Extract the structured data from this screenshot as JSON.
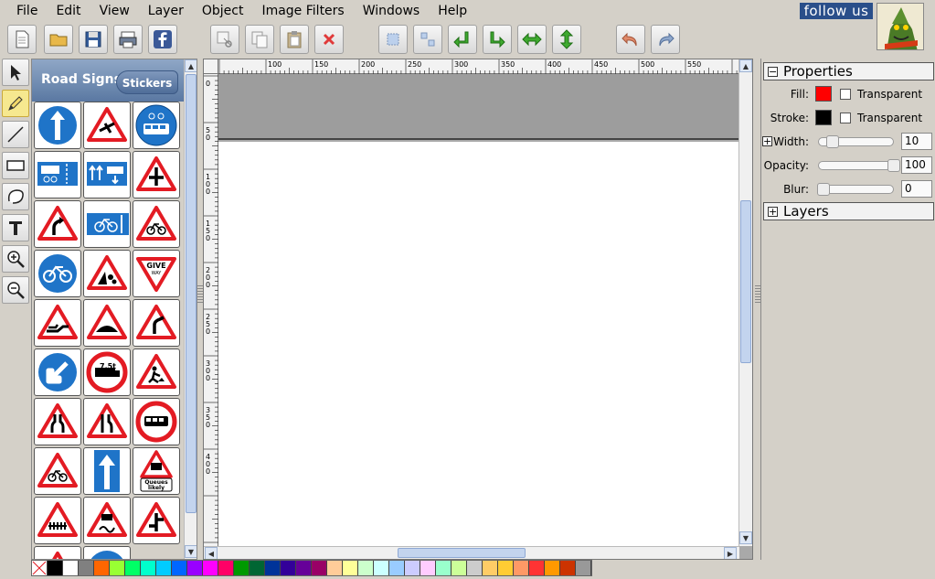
{
  "menu": {
    "items": [
      "File",
      "Edit",
      "View",
      "Layer",
      "Object",
      "Image Filters",
      "Windows",
      "Help"
    ]
  },
  "header": {
    "follow_us": "follow us"
  },
  "toolbar": {
    "buttons": [
      {
        "name": "new-document-button",
        "icon": "page-icon"
      },
      {
        "name": "open-button",
        "icon": "folder-icon"
      },
      {
        "name": "save-button",
        "icon": "floppy-icon"
      },
      {
        "name": "export-button",
        "icon": "printer-icon"
      },
      {
        "name": "facebook-button",
        "icon": "facebook-icon"
      },
      {
        "name": "cut-button",
        "icon": "scissors-icon"
      },
      {
        "name": "copy-button",
        "icon": "copy-icon"
      },
      {
        "name": "paste-button",
        "icon": "clipboard-icon"
      },
      {
        "name": "delete-button",
        "icon": "red-x-icon"
      },
      {
        "name": "group-button",
        "icon": "group-icon"
      },
      {
        "name": "ungroup-button",
        "icon": "ungroup-icon"
      },
      {
        "name": "bring-forward-button",
        "icon": "arrow-up-left-icon"
      },
      {
        "name": "send-backward-button",
        "icon": "arrow-down-right-icon"
      },
      {
        "name": "flip-horizontal-button",
        "icon": "arrow-left-right-icon"
      },
      {
        "name": "flip-vertical-button",
        "icon": "arrow-up-down-icon"
      },
      {
        "name": "undo-button",
        "icon": "undo-icon"
      },
      {
        "name": "redo-button",
        "icon": "redo-icon"
      }
    ]
  },
  "tools": [
    "select-tool",
    "pencil-tool",
    "line-tool",
    "rectangle-tool",
    "ellipse-tool",
    "text-tool",
    "zoom-in-tool",
    "zoom-out-tool"
  ],
  "library": {
    "title": "Road Signs",
    "stickers_label": "Stickers",
    "signs": [
      "ahead-only",
      "low-flying-aircraft",
      "bus-and-cycle-only",
      "bus-lane",
      "bus-lane-ahead",
      "crossroads",
      "bend-right",
      "cycle-route",
      "cycles-ahead",
      "cycle-path",
      "falling-rocks",
      "give-way",
      "quay-edge",
      "hump-bridge",
      "side-road",
      "keep-left",
      "no-goods-vehicles-7.5t",
      "road-works",
      "road-narrows-both",
      "road-narrows-right",
      "no-buses",
      "cycles-ahead",
      "one-way",
      "queues-likely",
      "level-crossing",
      "slippery-road",
      "staggered-junction",
      "warning",
      "keep-left"
    ],
    "give_way_text": "GIVE WAY",
    "goods_limit": "7.5t",
    "queues_text": "Queues likely"
  },
  "ruler": {
    "top_ticks": [
      "100",
      "150",
      "200",
      "250",
      "300",
      "350",
      "400",
      "450",
      "500",
      "550"
    ],
    "left_ticks": [
      "0",
      "50",
      "100",
      "150",
      "200",
      "250",
      "300",
      "350",
      "400"
    ]
  },
  "properties": {
    "title": "Properties",
    "fill_label": "Fill:",
    "fill_color": "#ff0000",
    "stroke_label": "Stroke:",
    "stroke_color": "#000000",
    "transparent_label": "Transparent",
    "width_label": "Width:",
    "width_value": "10",
    "opacity_label": "Opacity:",
    "opacity_value": "100",
    "blur_label": "Blur:",
    "blur_value": "0"
  },
  "layers": {
    "title": "Layers"
  },
  "palette": [
    "#ffffff",
    "#000000",
    "#ffffff",
    "#808080",
    "#ff6600",
    "#99ff33",
    "#00ff66",
    "#00ffcc",
    "#00ccff",
    "#0066ff",
    "#9900ff",
    "#ff00ff",
    "#ff0066",
    "#009900",
    "#006633",
    "#003399",
    "#330099",
    "#660099",
    "#990066",
    "#ffcc99",
    "#ffff99",
    "#ccffcc",
    "#ccffff",
    "#99ccff",
    "#ccccff",
    "#ffccff",
    "#99ffcc",
    "#ccff99",
    "#cccccc",
    "#ffcc66",
    "#ffcc33",
    "#ff9966",
    "#ff3333",
    "#ff9900",
    "#cc3300",
    "#999999"
  ]
}
